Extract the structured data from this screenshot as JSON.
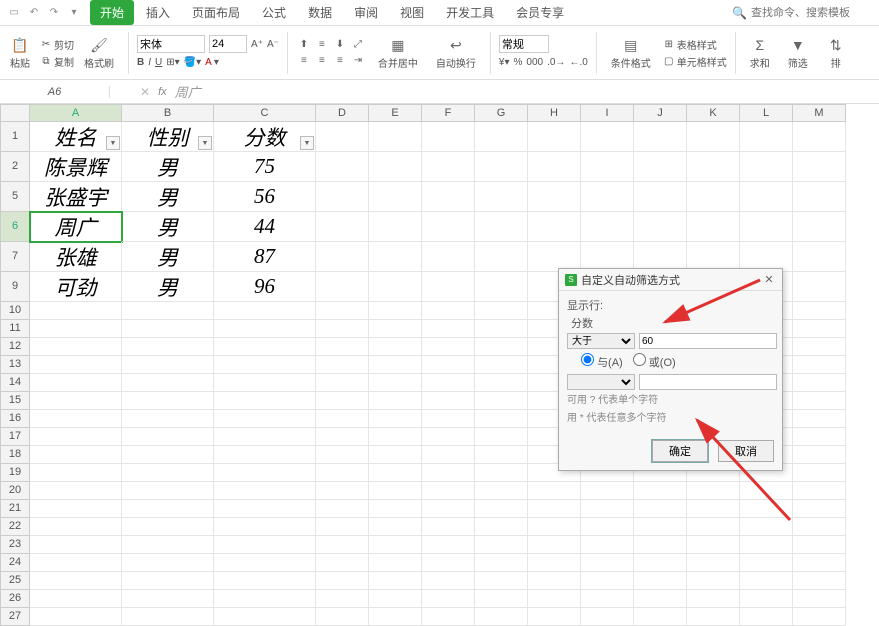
{
  "menu": {
    "tabs": [
      "开始",
      "插入",
      "页面布局",
      "公式",
      "数据",
      "审阅",
      "视图",
      "开发工具",
      "会员专享"
    ],
    "active_index": 0,
    "search_placeholder": "查找命令、搜索模板"
  },
  "ribbon": {
    "clipboard": {
      "cut": "剪切",
      "copy": "复制",
      "paste": "粘贴",
      "format_painter": "格式刷"
    },
    "font": {
      "name": "宋体",
      "size": "24"
    },
    "alignment": {
      "merge": "合并居中",
      "wrap": "自动换行"
    },
    "number": {
      "general": "常规"
    },
    "styles": {
      "cond_format": "条件格式",
      "table_style": "表格样式",
      "cell_style": "单元格样式"
    },
    "editing": {
      "sum": "求和",
      "filter": "筛选",
      "sort": "排"
    }
  },
  "namebox": "A6",
  "formula_content": "周广",
  "columns": [
    "A",
    "B",
    "C",
    "D",
    "E",
    "F",
    "G",
    "H",
    "I",
    "J",
    "K",
    "L",
    "M"
  ],
  "row_nums": [
    "1",
    "2",
    "5",
    "6",
    "7",
    "9",
    "10",
    "11",
    "12",
    "13",
    "14",
    "15",
    "16",
    "17",
    "18",
    "19",
    "20",
    "21",
    "22",
    "23",
    "24",
    "25",
    "26",
    "27"
  ],
  "data_rows": 6,
  "table": {
    "headers": [
      "姓名",
      "性别",
      "分数"
    ],
    "rows": [
      {
        "name": "陈景辉",
        "gender": "男",
        "score": "75"
      },
      {
        "name": "张盛宇",
        "gender": "男",
        "score": "56"
      },
      {
        "name": "周广",
        "gender": "男",
        "score": "44"
      },
      {
        "name": "张雄",
        "gender": "男",
        "score": "87"
      },
      {
        "name": "可劲",
        "gender": "男",
        "score": "96"
      }
    ],
    "active_cell": {
      "row": 3,
      "col": 0
    }
  },
  "dialog": {
    "title": "自定义自动筛选方式",
    "show_label": "显示行:",
    "field_label": "分数",
    "condition1": {
      "op": "大于",
      "value": "60"
    },
    "logic_and": "与(A)",
    "logic_or": "或(O)",
    "condition2": {
      "op": "",
      "value": ""
    },
    "hint1": "可用 ? 代表单个字符",
    "hint2": "用 * 代表任意多个字符",
    "ok": "确定",
    "cancel": "取消"
  }
}
